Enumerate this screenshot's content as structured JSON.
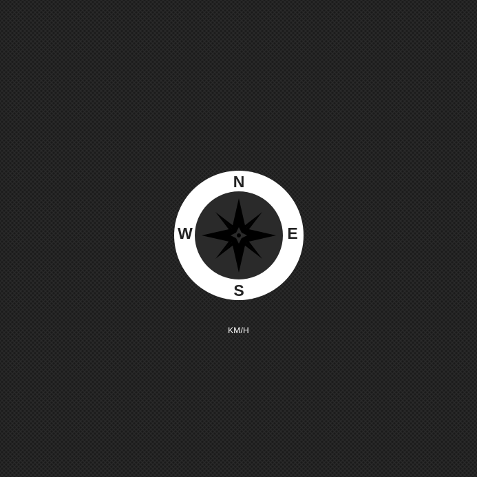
{
  "compass": {
    "icon": "compass-rose-icon",
    "ring_color": "#ffffff",
    "rose_color": "#000000",
    "labels": {
      "north": "N",
      "east": "E",
      "south": "S",
      "west": "W"
    }
  },
  "speed": {
    "unit_label": "KM/H"
  },
  "colors": {
    "background": "#2a2a2a",
    "text": "#ffffff"
  }
}
